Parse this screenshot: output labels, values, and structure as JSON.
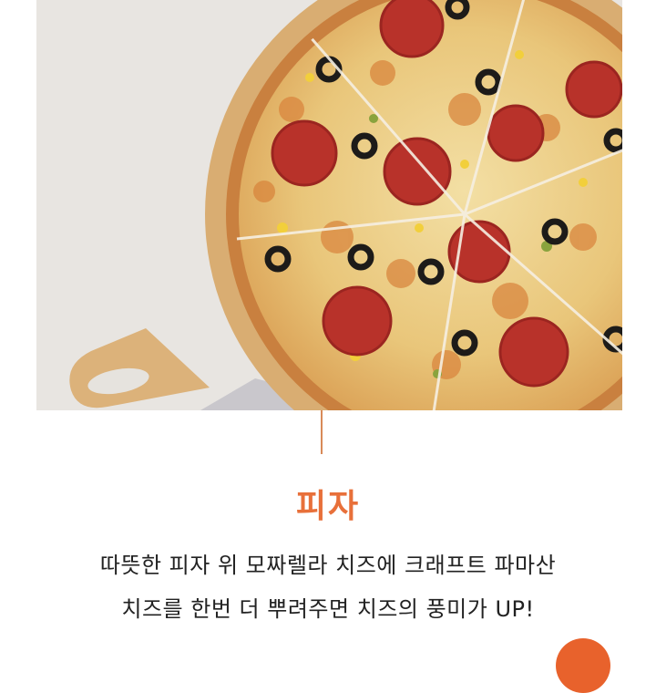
{
  "product": {
    "title": "피자",
    "description_line1": "따뜻한 피자 위 모짜렐라 치즈에 크래프트 파마산",
    "description_line2": "치즈를 한번 더 뿌려주면 치즈의 풍미가 UP!"
  },
  "colors": {
    "accent": "#e8622c",
    "title": "#e8703a",
    "divider": "#d98a58",
    "text": "#222222"
  },
  "icons": {
    "scroll_button": "circle-button"
  }
}
